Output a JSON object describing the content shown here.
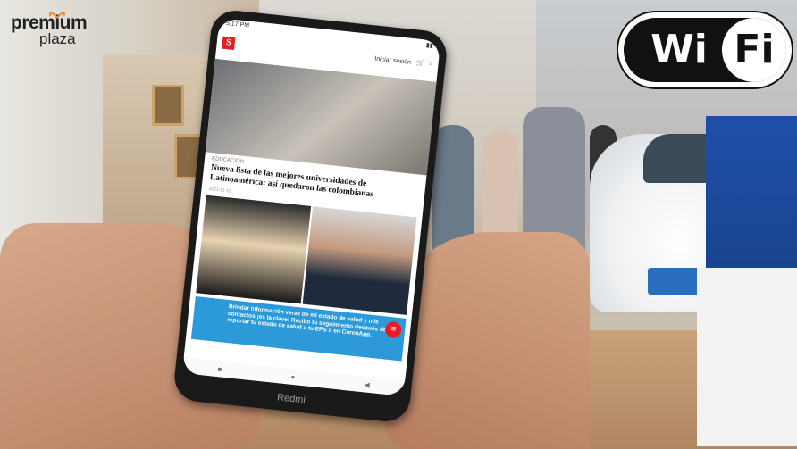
{
  "logo": {
    "line1": "premium",
    "line2": "plaza"
  },
  "wifi_badge": {
    "left": "Wi",
    "right": "Fi"
  },
  "phone": {
    "brand": "Redmi",
    "status_time": "5:17 PM",
    "login_label": "Iniciar sesión",
    "site_logo": "S",
    "article": {
      "category": "EDUCACIÓN",
      "headline": "Nueva lista de las mejores universidades de Latinoamérica: así quedaron las colombianas",
      "date": "2021-11-11"
    },
    "banner_text": "Brindar información veraz de mi estado de salud y mis contactos ¡es la clave! Recibo tu seguimiento después de reportar tu estado de salud a tu EPS o en CoronApp."
  },
  "colors": {
    "accent": "#e31e24",
    "banner": "#2c9ad8"
  }
}
